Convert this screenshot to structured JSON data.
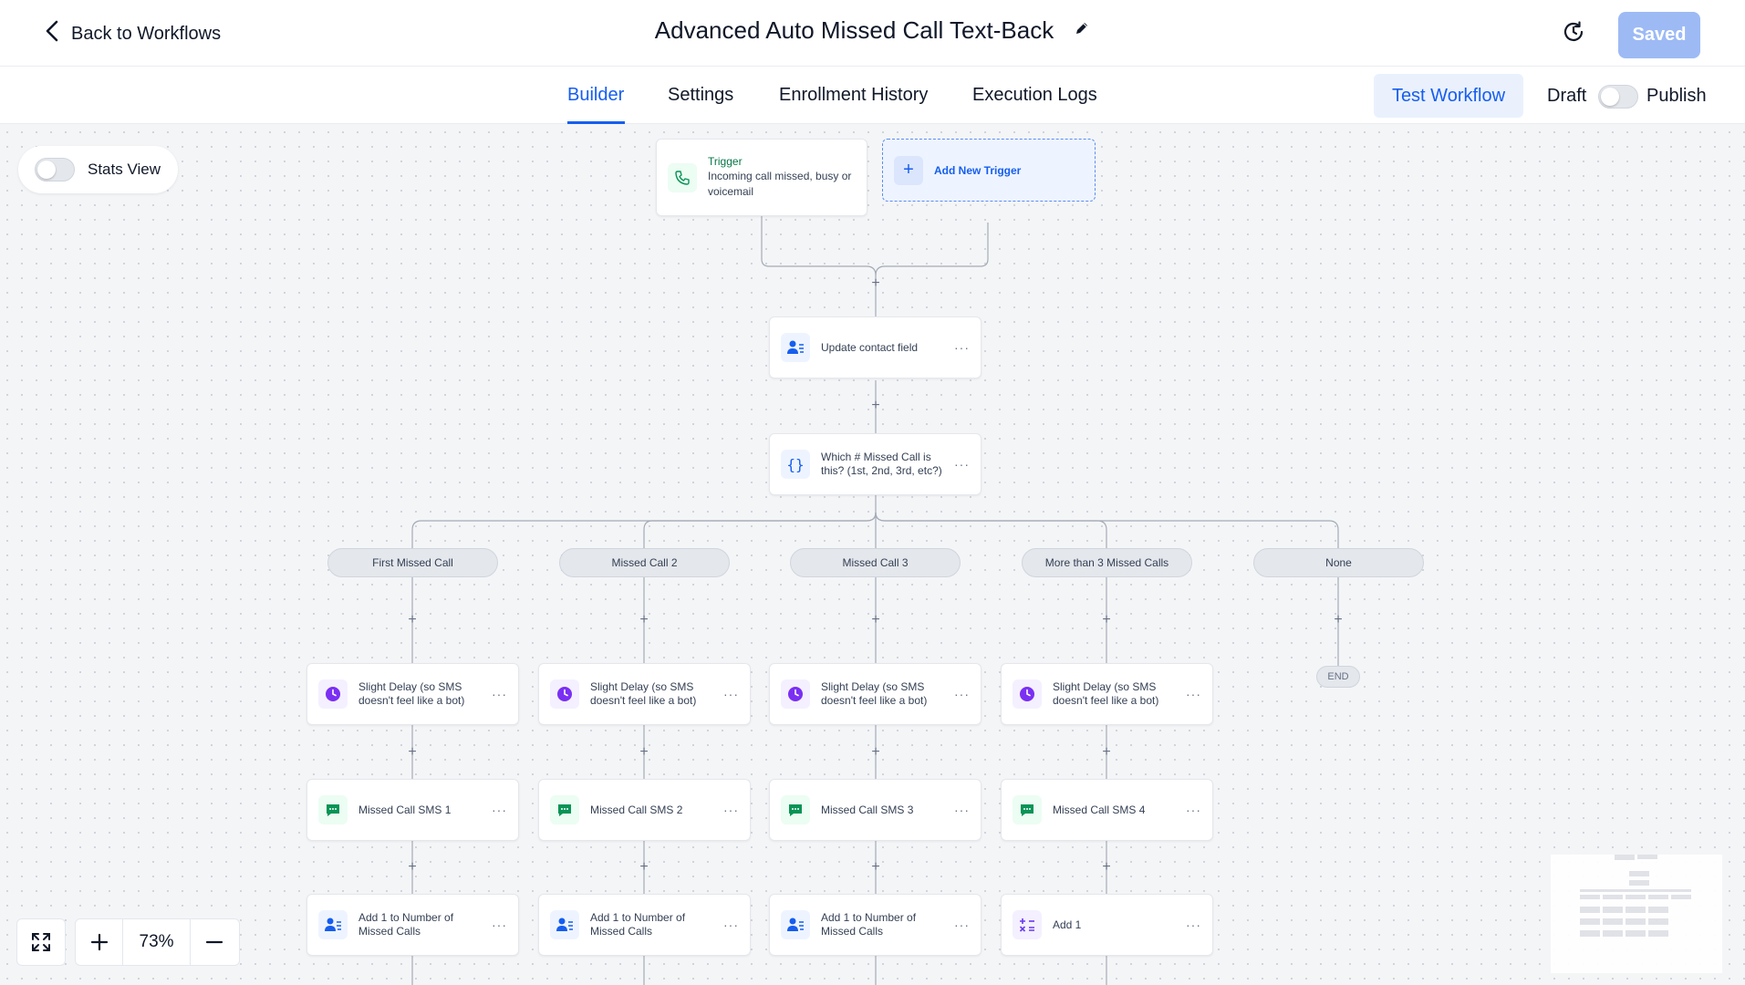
{
  "header": {
    "back_label": "Back to Workflows",
    "title": "Advanced Auto Missed Call Text-Back",
    "saved_label": "Saved"
  },
  "tabs": [
    {
      "label": "Builder",
      "active": true
    },
    {
      "label": "Settings",
      "active": false
    },
    {
      "label": "Enrollment History",
      "active": false
    },
    {
      "label": "Execution Logs",
      "active": false
    }
  ],
  "actions": {
    "test_label": "Test Workflow",
    "draft_label": "Draft",
    "publish_label": "Publish",
    "published": false
  },
  "canvas": {
    "stats_view_label": "Stats View",
    "stats_view_on": false,
    "zoom": "73%"
  },
  "workflow": {
    "trigger": {
      "label": "Trigger",
      "description": "Incoming call missed, busy or voicemail"
    },
    "add_trigger_label": "Add New Trigger",
    "update_node": "Update contact field",
    "condition_node": "Which # Missed Call is this? (1st, 2nd, 3rd, etc?)",
    "branches": [
      {
        "label": "First Missed Call",
        "steps": [
          "Slight Delay (so SMS doesn't feel like a bot)",
          "Missed Call SMS 1",
          "Add 1 to Number of Missed Calls"
        ]
      },
      {
        "label": "Missed Call 2",
        "steps": [
          "Slight Delay (so SMS doesn't feel like a bot)",
          "Missed Call SMS 2",
          "Add 1 to Number of Missed Calls"
        ]
      },
      {
        "label": "Missed Call 3",
        "steps": [
          "Slight Delay (so SMS doesn't feel like a bot)",
          "Missed Call SMS 3",
          "Add 1 to Number of Missed Calls"
        ]
      },
      {
        "label": "More than 3 Missed Calls",
        "steps": [
          "Slight Delay (so SMS doesn't feel like a bot)",
          "Missed Call SMS 4",
          "Add 1"
        ]
      },
      {
        "label": "None",
        "end_label": "END"
      }
    ],
    "step_icons": [
      "clock-icon",
      "message-icon",
      "contact-update-icon"
    ],
    "last_step_icon_branch4": "math-operation-icon"
  },
  "colors": {
    "accent": "#155eef",
    "saved_button": "#9dbaf5",
    "delay_icon": "#7a2ff3",
    "sms_icon": "#079455",
    "trigger_text": "#067647"
  }
}
